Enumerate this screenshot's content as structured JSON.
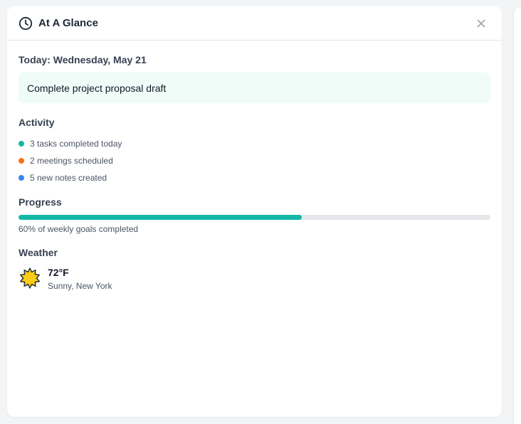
{
  "panel": {
    "title": "At A Glance",
    "icon": "clock-icon",
    "close_icon": "close-icon"
  },
  "today": {
    "label": "Today: Wednesday, May 21",
    "focus_task": "Complete project proposal draft"
  },
  "activity": {
    "title": "Activity",
    "items": [
      {
        "text": "3 tasks completed today",
        "color": "#14b8a6"
      },
      {
        "text": "2 meetings scheduled",
        "color": "#f97316"
      },
      {
        "text": "5 new notes created",
        "color": "#3b82f6"
      }
    ]
  },
  "progress": {
    "title": "Progress",
    "percent": 60,
    "caption": "60% of weekly goals completed",
    "color": "#14b8a6"
  },
  "weather": {
    "title": "Weather",
    "icon": "sun-icon",
    "temperature": "72°F",
    "condition": "Sunny, New York"
  }
}
